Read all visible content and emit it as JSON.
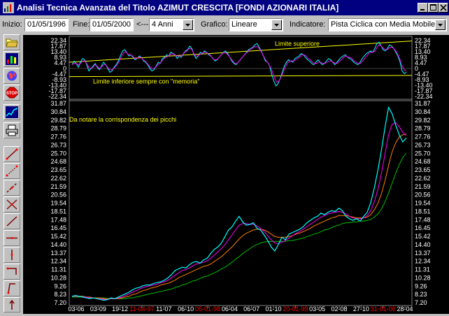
{
  "window": {
    "title": "Analisi Tecnica Avanzata del Titolo  AZIMUT CRESCITA  [FONDI AZIONARI ITALIA]"
  },
  "toolbar": {
    "inizio_label": "Inizio:",
    "inizio_value": "01/05/1996",
    "fine_label": "Fine:",
    "fine_value": "01/05/2000",
    "period_arrow": "<---",
    "period_value": "4 Anni",
    "grafico_label": "Grafico:",
    "grafico_value": "Lineare",
    "indicatore_label": "Indicatore:",
    "indicatore_value": "Pista Ciclica con Media Mobile"
  },
  "sidebar": {
    "icons": [
      "folder-icon",
      "bar-chart-icon",
      "globe-icon",
      "stop-icon",
      "line-chart-icon",
      "printer-icon",
      "trendline-icon",
      "dotted-line-icon",
      "dashed-line-icon",
      "cross-line-icon",
      "diagonal-line-icon",
      "horizontal-line-icon",
      "vertical-line-icon",
      "bracket-line-icon",
      "angled-line-icon",
      "vertical-arrow-icon",
      "rectangle-icon"
    ]
  },
  "colors": {
    "price": "#00ffff",
    "ma_short": "#ff00ff",
    "ma_mid": "#ff8000",
    "ma_long": "#00c000",
    "limit": "#ffff00",
    "axis_text": "#ffffff",
    "highlight_date": "#ff0000"
  },
  "chart_data": [
    {
      "type": "line",
      "name": "oscillator",
      "y_ticks": [
        "22.34",
        "17.87",
        "13.40",
        "8.93",
        "4.47",
        "0",
        "-4.47",
        "-8.93",
        "-13.40",
        "-17.87",
        "-22.34"
      ],
      "ylim": [
        -22.34,
        22.34
      ],
      "annotations": [
        "Limite superiore",
        "Limite inferiore sempre con \"memoria\""
      ],
      "upper_limit": [
        [
          0,
          5.0
        ],
        [
          1,
          22.0
        ]
      ],
      "lower_limit": [
        [
          0,
          -6.5
        ],
        [
          1,
          -5.5
        ]
      ],
      "oscillator_values": [
        3,
        6,
        4,
        1,
        5,
        8,
        7,
        3,
        -2,
        0,
        2,
        4,
        1,
        -1,
        2,
        5,
        3,
        0,
        -3,
        -2,
        1,
        3,
        6,
        10,
        14,
        15,
        13,
        10,
        11,
        9,
        7,
        8,
        10,
        9,
        6,
        5,
        3,
        0,
        -2,
        -1,
        2,
        5,
        4,
        8,
        9,
        11,
        10,
        13,
        12,
        11,
        8,
        10,
        9,
        12,
        14,
        15,
        18,
        16,
        11,
        8,
        10,
        13,
        12,
        14,
        13,
        11,
        10,
        8,
        6,
        7,
        9,
        11,
        13,
        14,
        12,
        9,
        6,
        4,
        3,
        5,
        7,
        9,
        11,
        13,
        15,
        16,
        17,
        19,
        20,
        17,
        14,
        10,
        6,
        5,
        2,
        -5,
        -10,
        -14,
        -12,
        -8,
        -3,
        2,
        5,
        7,
        6,
        5,
        8,
        9,
        10,
        12,
        11,
        9,
        7,
        6,
        4,
        3,
        5,
        7,
        5,
        3,
        4,
        6,
        8,
        7,
        5,
        3,
        5,
        7,
        9,
        10,
        11,
        9,
        8,
        7,
        5,
        4,
        3,
        5,
        8,
        10,
        12,
        13,
        14,
        13,
        16,
        20,
        21,
        18,
        15,
        14,
        16,
        19,
        18,
        16,
        13,
        10,
        5,
        -2,
        -4,
        -3
      ],
      "signal_values": [
        3,
        4,
        4,
        3,
        4,
        6,
        6,
        4,
        1,
        0,
        1,
        3,
        2,
        0,
        1,
        3,
        3,
        1,
        -1,
        -1,
        0,
        2,
        4,
        7,
        11,
        13,
        13,
        11,
        11,
        10,
        8,
        8,
        9,
        9,
        7,
        6,
        4,
        2,
        0,
        0,
        1,
        3,
        4,
        6,
        8,
        9,
        10,
        11,
        12,
        11,
        10,
        10,
        10,
        11,
        13,
        14,
        16,
        16,
        13,
        10,
        10,
        11,
        12,
        13,
        13,
        12,
        11,
        9,
        7,
        7,
        8,
        10,
        12,
        13,
        12,
        10,
        8,
        6,
        4,
        4,
        6,
        8,
        10,
        12,
        13,
        15,
        16,
        17,
        18,
        17,
        15,
        12,
        9,
        6,
        4,
        1,
        -3,
        -8,
        -11,
        -10,
        -7,
        -3,
        1,
        4,
        6,
        6,
        6,
        7,
        8,
        9,
        11,
        11,
        10,
        8,
        7,
        5,
        4,
        4,
        5,
        5,
        4,
        4,
        5,
        6,
        6,
        5,
        4,
        4,
        6,
        7,
        9,
        10,
        9,
        9,
        8,
        6,
        5,
        4,
        4,
        6,
        8,
        10,
        12,
        13,
        13,
        14,
        17,
        19,
        18,
        16,
        15,
        15,
        17,
        17,
        16,
        14,
        11,
        7,
        2,
        -1,
        -2
      ]
    },
    {
      "type": "line",
      "name": "price",
      "y_ticks": [
        "31.87",
        "30.84",
        "29.82",
        "28.79",
        "27.76",
        "26.73",
        "25.70",
        "24.68",
        "23.65",
        "22.62",
        "21.59",
        "20.56",
        "19.54",
        "18.51",
        "17.48",
        "16.45",
        "15.42",
        "14.40",
        "13.37",
        "12.34",
        "11.31",
        "10.28",
        "9.26",
        "8.23",
        "7.20"
      ],
      "ylim": [
        7.2,
        31.87
      ],
      "x_ticks": [
        {
          "label": "03-06",
          "red": false
        },
        {
          "label": "03-09",
          "red": false
        },
        {
          "label": "19-12",
          "red": false
        },
        {
          "label": "11-04-97",
          "red": true
        },
        {
          "label": "11-07",
          "red": false
        },
        {
          "label": "06-10",
          "red": false
        },
        {
          "label": "05-01-98",
          "red": true
        },
        {
          "label": "06-04",
          "red": false
        },
        {
          "label": "06-07",
          "red": false
        },
        {
          "label": "01-10",
          "red": false
        },
        {
          "label": "20-01-99",
          "red": true
        },
        {
          "label": "03-05",
          "red": false
        },
        {
          "label": "02-08",
          "red": false
        },
        {
          "label": "27-10",
          "red": false
        },
        {
          "label": "31-01-00",
          "red": true
        },
        {
          "label": "28-04",
          "red": false
        }
      ],
      "annotation": "Da notare la corrispondenza dei picchi",
      "price_values": [
        8.0,
        8.1,
        8.0,
        7.9,
        7.8,
        7.7,
        7.8,
        7.7,
        7.6,
        7.5,
        7.6,
        7.8,
        7.7,
        7.9,
        8.1,
        8.3,
        8.5,
        8.8,
        9.0,
        9.1,
        9.3,
        9.4,
        9.4,
        9.6,
        9.7,
        9.8,
        10.0,
        10.3,
        10.7,
        11.2,
        11.4,
        11.6,
        11.5,
        11.9,
        12.2,
        12.3,
        12.1,
        12.5,
        12.7,
        13.3,
        13.8,
        14.1,
        14.6,
        15.4,
        16.2,
        16.6,
        17.3,
        17.9,
        17.2,
        16.8,
        16.9,
        17.1,
        16.4,
        16.2,
        15.6,
        14.9,
        14.1,
        13.6,
        14.4,
        15.3,
        15.0,
        15.7,
        15.9,
        16.1,
        16.3,
        16.6,
        17.1,
        17.4,
        17.7,
        17.9,
        18.3,
        18.1,
        18.4,
        18.6,
        18.5,
        18.9,
        18.6,
        17.9,
        17.6,
        17.4,
        17.6,
        17.3,
        17.9,
        18.4,
        19.6,
        21.4,
        23.6,
        26.1,
        28.9,
        31.4,
        30.6,
        29.2,
        28.0,
        27.1,
        27.6
      ],
      "ma_short": [
        8.0,
        8.0,
        8.0,
        7.9,
        7.9,
        7.8,
        7.8,
        7.7,
        7.7,
        7.6,
        7.6,
        7.7,
        7.7,
        7.8,
        7.9,
        8.1,
        8.3,
        8.5,
        8.7,
        8.9,
        9.1,
        9.2,
        9.3,
        9.4,
        9.5,
        9.7,
        9.8,
        10.0,
        10.3,
        10.6,
        10.9,
        11.2,
        11.3,
        11.5,
        11.8,
        12.0,
        12.1,
        12.2,
        12.4,
        12.7,
        13.1,
        13.5,
        13.9,
        14.4,
        15.0,
        15.6,
        16.2,
        16.8,
        17.0,
        17.0,
        16.9,
        16.9,
        16.7,
        16.4,
        16.0,
        15.5,
        15.0,
        14.6,
        14.5,
        14.7,
        14.9,
        15.2,
        15.5,
        15.8,
        16.0,
        16.3,
        16.6,
        16.9,
        17.2,
        17.5,
        17.8,
        18.0,
        18.2,
        18.3,
        18.4,
        18.5,
        18.4,
        18.2,
        17.9,
        17.7,
        17.6,
        17.6,
        17.7,
        18.0,
        18.6,
        19.7,
        21.2,
        23.2,
        25.6,
        28.0,
        29.3,
        29.5,
        29.0,
        28.3,
        27.9
      ],
      "ma_mid": [
        8.0,
        8.0,
        8.0,
        8.0,
        7.9,
        7.9,
        7.8,
        7.8,
        7.8,
        7.7,
        7.7,
        7.7,
        7.7,
        7.7,
        7.8,
        7.9,
        8.0,
        8.2,
        8.3,
        8.5,
        8.7,
        8.8,
        9.0,
        9.1,
        9.2,
        9.4,
        9.5,
        9.6,
        9.8,
        10.0,
        10.3,
        10.5,
        10.7,
        10.9,
        11.1,
        11.3,
        11.5,
        11.7,
        11.8,
        12.0,
        12.3,
        12.6,
        12.9,
        13.3,
        13.7,
        14.1,
        14.6,
        15.1,
        15.5,
        15.8,
        16.0,
        16.2,
        16.3,
        16.3,
        16.2,
        16.0,
        15.7,
        15.4,
        15.3,
        15.3,
        15.3,
        15.4,
        15.5,
        15.7,
        15.8,
        16.0,
        16.2,
        16.4,
        16.7,
        16.9,
        17.1,
        17.3,
        17.5,
        17.7,
        17.8,
        18.0,
        18.0,
        18.0,
        17.9,
        17.8,
        17.7,
        17.7,
        17.7,
        17.8,
        18.1,
        18.7,
        19.5,
        20.7,
        22.3,
        24.2,
        25.9,
        27.0,
        27.7,
        28.0,
        28.1
      ],
      "ma_long": [
        7.9,
        7.9,
        7.9,
        7.9,
        7.9,
        7.8,
        7.8,
        7.8,
        7.8,
        7.8,
        7.7,
        7.7,
        7.7,
        7.7,
        7.7,
        7.7,
        7.8,
        7.8,
        7.9,
        8.0,
        8.1,
        8.2,
        8.3,
        8.4,
        8.5,
        8.6,
        8.7,
        8.8,
        8.9,
        9.1,
        9.2,
        9.4,
        9.5,
        9.7,
        9.9,
        10.0,
        10.2,
        10.4,
        10.5,
        10.7,
        10.9,
        11.1,
        11.4,
        11.6,
        11.9,
        12.2,
        12.6,
        12.9,
        13.3,
        13.6,
        13.9,
        14.2,
        14.4,
        14.6,
        14.7,
        14.8,
        14.8,
        14.8,
        14.8,
        14.8,
        14.8,
        14.9,
        14.9,
        15.0,
        15.1,
        15.2,
        15.4,
        15.5,
        15.7,
        15.8,
        16.0,
        16.2,
        16.3,
        16.5,
        16.7,
        16.8,
        17.0,
        17.1,
        17.1,
        17.2,
        17.2,
        17.3,
        17.3,
        17.4,
        17.5,
        17.8,
        18.2,
        18.8,
        19.7,
        20.8,
        22.0,
        23.2,
        24.3,
        25.2,
        25.7
      ]
    }
  ]
}
